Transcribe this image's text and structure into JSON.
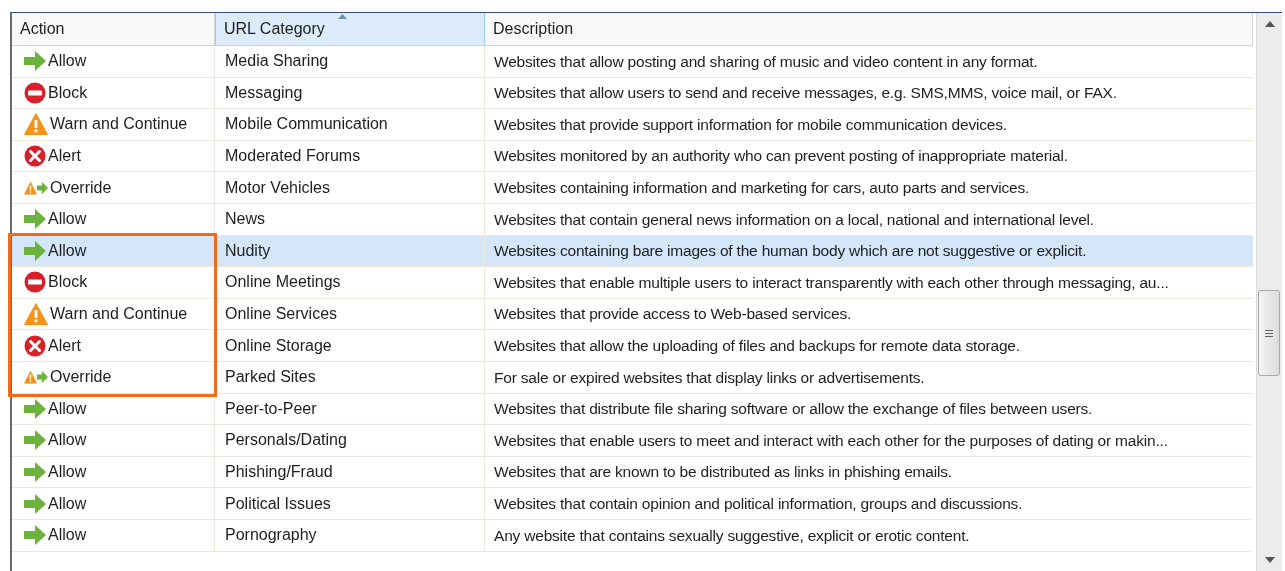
{
  "table": {
    "columns": [
      {
        "label": "Action",
        "sorted": false
      },
      {
        "label": "URL Category",
        "sorted": true
      },
      {
        "label": "Description",
        "sorted": false
      }
    ],
    "rows": [
      {
        "kind": "allow",
        "action": "Allow",
        "category": "Media Sharing",
        "description": "Websites that allow posting and sharing of music and video content in any format.",
        "selected": false,
        "outlined": false
      },
      {
        "kind": "block",
        "action": "Block",
        "category": "Messaging",
        "description": "Websites that allow users to send and receive messages, e.g. SMS,MMS, voice mail, or FAX.",
        "selected": false,
        "outlined": false
      },
      {
        "kind": "warn",
        "action": "Warn and Continue",
        "category": "Mobile Communication",
        "description": "Websites that provide support information for mobile communication devices.",
        "selected": false,
        "outlined": false
      },
      {
        "kind": "alert",
        "action": "Alert",
        "category": "Moderated Forums",
        "description": "Websites monitored by an authority who can prevent posting of inappropriate material.",
        "selected": false,
        "outlined": false
      },
      {
        "kind": "override",
        "action": "Override",
        "category": "Motor Vehicles",
        "description": "Websites containing information and marketing for cars, auto parts and services.",
        "selected": false,
        "outlined": false
      },
      {
        "kind": "allow",
        "action": "Allow",
        "category": "News",
        "description": "Websites that contain general news information on a local, national and international level.",
        "selected": false,
        "outlined": false
      },
      {
        "kind": "allow",
        "action": "Allow",
        "category": "Nudity",
        "description": "Websites containing bare images of the human body which are not suggestive or explicit.",
        "selected": true,
        "outlined": true
      },
      {
        "kind": "block",
        "action": "Block",
        "category": "Online Meetings",
        "description": "Websites that enable multiple users to interact transparently with each other through messaging, au...",
        "selected": false,
        "outlined": true
      },
      {
        "kind": "warn",
        "action": "Warn and Continue",
        "category": "Online Services",
        "description": "Websites that provide access to Web-based services.",
        "selected": false,
        "outlined": true
      },
      {
        "kind": "alert",
        "action": "Alert",
        "category": "Online Storage",
        "description": "Websites that allow the uploading of files and backups for remote data storage.",
        "selected": false,
        "outlined": true
      },
      {
        "kind": "override",
        "action": "Override",
        "category": "Parked Sites",
        "description": "For sale or expired websites that display links or advertisements.",
        "selected": false,
        "outlined": true
      },
      {
        "kind": "allow",
        "action": "Allow",
        "category": "Peer-to-Peer",
        "description": "Websites that distribute file sharing software or allow the exchange of files between users.",
        "selected": false,
        "outlined": false
      },
      {
        "kind": "allow",
        "action": "Allow",
        "category": "Personals/Dating",
        "description": "Websites that enable users to meet and interact with each other for the purposes of dating or makin...",
        "selected": false,
        "outlined": false
      },
      {
        "kind": "allow",
        "action": "Allow",
        "category": "Phishing/Fraud",
        "description": "Websites that are known to be distributed as links in phishing emails.",
        "selected": false,
        "outlined": false
      },
      {
        "kind": "allow",
        "action": "Allow",
        "category": "Political Issues",
        "description": "Websites that contain opinion and political information, groups and discussions.",
        "selected": false,
        "outlined": false
      },
      {
        "kind": "allow",
        "action": "Allow",
        "category": "Pornography",
        "description": "Any website that contains sexually suggestive, explicit or erotic content.",
        "selected": false,
        "outlined": false
      }
    ]
  }
}
